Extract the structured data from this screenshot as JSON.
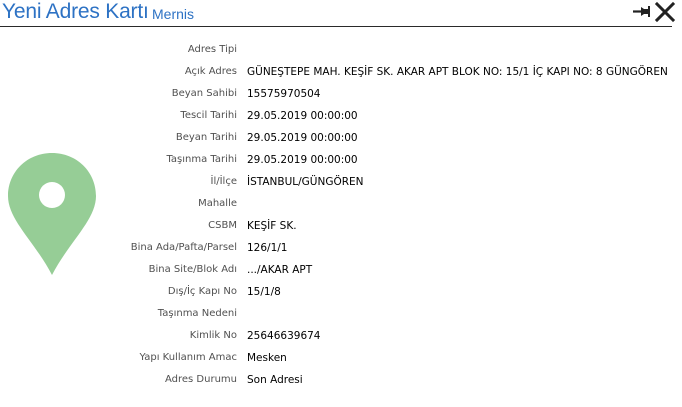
{
  "header": {
    "title": "Yeni Adres Kartı",
    "subtitle": "Mernis",
    "pin_icon": "pin-icon",
    "close_icon": "close-icon"
  },
  "map_icon": "map-pin-icon",
  "colors": {
    "accent": "#2d72c4",
    "pin": "#96cd96"
  },
  "fields": [
    {
      "label": "Adres Tipi",
      "value": ""
    },
    {
      "label": "Açık Adres",
      "value": "GÜNEŞTEPE MAH. KEŞİF SK. AKAR APT BLOK  NO: 15/1  İÇ KAPI NO: 8 GÜNGÖREN"
    },
    {
      "label": "Beyan Sahibi",
      "value": "15575970504"
    },
    {
      "label": "Tescil Tarihi",
      "value": "29.05.2019 00:00:00"
    },
    {
      "label": "Beyan Tarihi",
      "value": "29.05.2019 00:00:00"
    },
    {
      "label": "Taşınma Tarihi",
      "value": "29.05.2019 00:00:00"
    },
    {
      "label": "İl/İlçe",
      "value": "İSTANBUL/GÜNGÖREN"
    },
    {
      "label": "Mahalle",
      "value": ""
    },
    {
      "label": "CSBM",
      "value": "KEŞİF SK."
    },
    {
      "label": "Bina Ada/Pafta/Parsel",
      "value": "126/1/1"
    },
    {
      "label": "Bina Site/Blok Adı",
      "value": ".../AKAR APT"
    },
    {
      "label": "Dış/İç Kapı No",
      "value": "15/1/8"
    },
    {
      "label": "Taşınma Nedeni",
      "value": ""
    },
    {
      "label": "Kimlik No",
      "value": "25646639674"
    },
    {
      "label": "Yapı Kullanım Amac",
      "value": "Mesken"
    },
    {
      "label": "Adres Durumu",
      "value": "Son Adresi"
    }
  ]
}
